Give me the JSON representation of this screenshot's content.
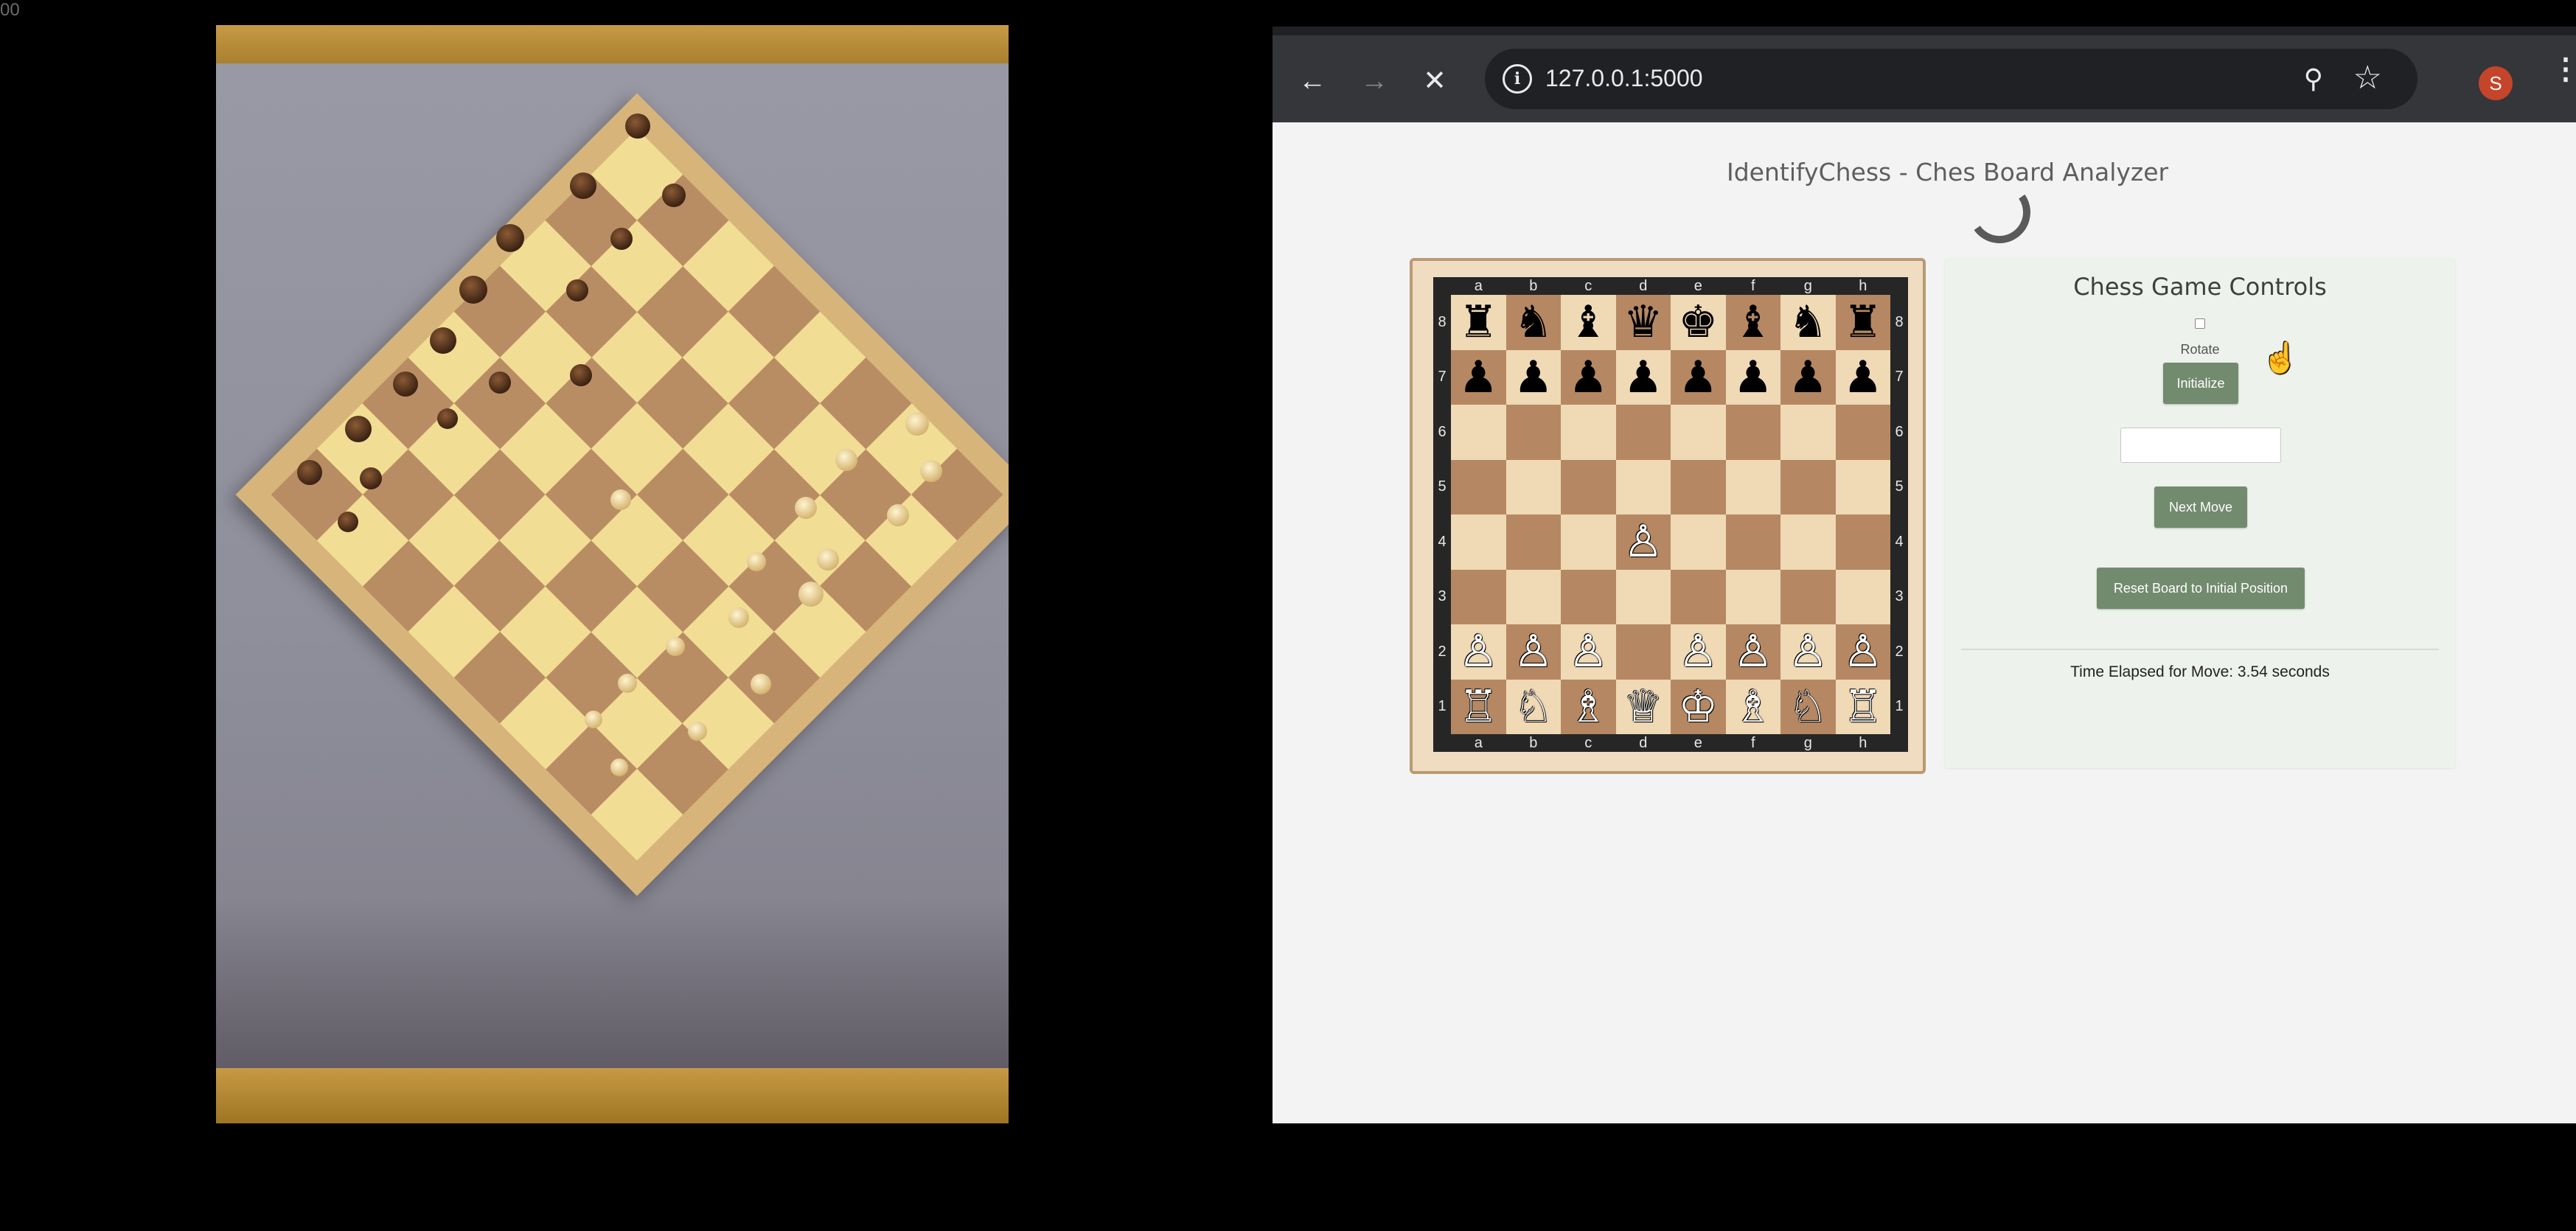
{
  "corner_label": "00",
  "browser": {
    "url": "127.0.0.1:5000",
    "profile_initial": "S"
  },
  "page": {
    "title": "IdentifyChess - Ches Board Analyzer"
  },
  "board": {
    "files": [
      "a",
      "b",
      "c",
      "d",
      "e",
      "f",
      "g",
      "h"
    ],
    "ranks": [
      "8",
      "7",
      "6",
      "5",
      "4",
      "3",
      "2",
      "1"
    ],
    "squares": [
      [
        "♜",
        "♞",
        "♝",
        "♛",
        "♚",
        "♝",
        "♞",
        "♜"
      ],
      [
        "♟",
        "♟",
        "♟",
        "♟",
        "♟",
        "♟",
        "♟",
        "♟"
      ],
      [
        "",
        "",
        "",
        "",
        "",
        "",
        "",
        ""
      ],
      [
        "",
        "",
        "",
        "",
        "",
        "",
        "",
        ""
      ],
      [
        "",
        "",
        "",
        "♙",
        "",
        "",
        "",
        ""
      ],
      [
        "",
        "",
        "",
        "",
        "",
        "",
        "",
        ""
      ],
      [
        "♙",
        "♙",
        "♙",
        "",
        "♙",
        "♙",
        "♙",
        "♙"
      ],
      [
        "♖",
        "♘",
        "♗",
        "♕",
        "♔",
        "♗",
        "♘",
        "♖"
      ]
    ]
  },
  "controls": {
    "title": "Chess Game Controls",
    "rotate_label": "Rotate",
    "initialize_label": "Initialize",
    "move_input_value": "",
    "next_move_label": "Next Move",
    "reset_label": "Reset Board to Initial Position",
    "time_elapsed": "Time Elapsed for Move: 3.54 seconds"
  },
  "colors": {
    "button_green": "#728b6e",
    "board_light": "#f0d9b5",
    "board_dark": "#b58863",
    "toolbar": "#35363a"
  }
}
